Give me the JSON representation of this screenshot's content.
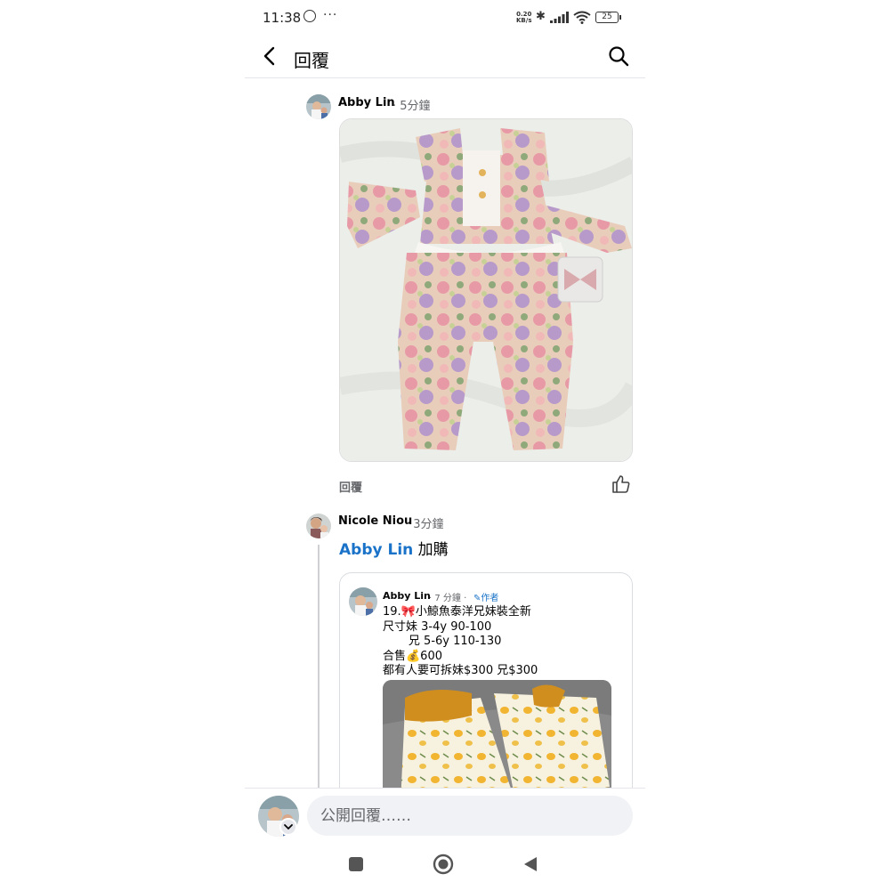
{
  "status_bar": {
    "time": "11:38",
    "more": "···",
    "net_speed_value": "0.20",
    "net_speed_unit": "KB/s",
    "battery": "25"
  },
  "header": {
    "title": "回覆"
  },
  "comments": [
    {
      "author": "Abby Lin",
      "time": "· 5分鐘",
      "reply_label": "回覆"
    },
    {
      "author": "Nicole Niou",
      "time": "· 3分鐘",
      "mention": "Abby Lin",
      "text": "加購",
      "shared_post": {
        "author": "Abby Lin",
        "time": "· 7 分鐘 ·",
        "badge": "作者",
        "lines": [
          "19.🎀小鯨魚泰洋兄妹裝全新",
          "尺寸妹 3-4y 90-100",
          "       兄 5-6y 110-130",
          "合售💰600",
          "都有人要可拆妹$300 兄$300"
        ]
      }
    }
  ],
  "composer": {
    "placeholder": "公開回覆……"
  },
  "colors": {
    "link": "#1a73c8",
    "meta": "#65676b",
    "bubble": "#f0f2f5"
  }
}
